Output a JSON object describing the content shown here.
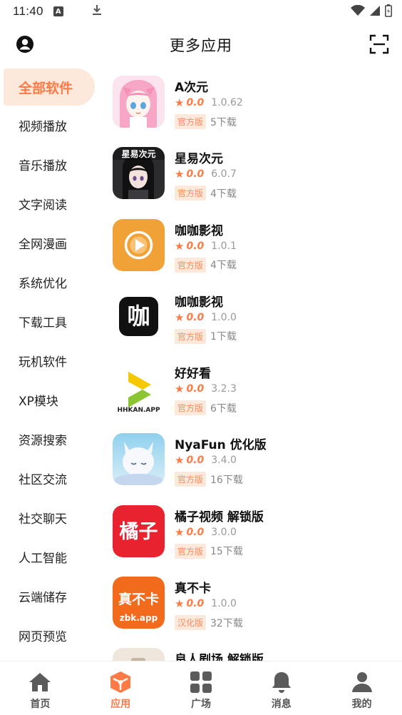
{
  "status_bar": {
    "time": "11:40",
    "a_badge": "A"
  },
  "header": {
    "title": "更多应用"
  },
  "sidebar": {
    "items": [
      {
        "label": "全部软件",
        "active": true
      },
      {
        "label": "视频播放"
      },
      {
        "label": "音乐播放"
      },
      {
        "label": "文字阅读"
      },
      {
        "label": "全网漫画"
      },
      {
        "label": "系统优化"
      },
      {
        "label": "下载工具"
      },
      {
        "label": "玩机软件"
      },
      {
        "label": "XP模块"
      },
      {
        "label": "资源搜索"
      },
      {
        "label": "社区交流"
      },
      {
        "label": "社交聊天"
      },
      {
        "label": "人工智能"
      },
      {
        "label": "云端储存"
      },
      {
        "label": "网页预览"
      }
    ]
  },
  "apps": [
    {
      "name": "A次元",
      "rating": "0.0",
      "version": "1.0.62",
      "tag": "官方版",
      "downloads": "5下载",
      "icon": "anime-girl-pink-icon"
    },
    {
      "name": "星易次元",
      "rating": "0.0",
      "version": "6.0.7",
      "tag": "官方版",
      "downloads": "4下载",
      "icon": "anime-girl-dark-icon",
      "icon_text": "星易次元"
    },
    {
      "name": "咖咖影视",
      "rating": "0.0",
      "version": "1.0.1",
      "tag": "官方版",
      "downloads": "4下载",
      "icon": "play-circle-icon"
    },
    {
      "name": "咖咖影视",
      "rating": "0.0",
      "version": "1.0.0",
      "tag": "官方版",
      "downloads": "1下载",
      "icon": "ka-logo-icon",
      "icon_text": "咖"
    },
    {
      "name": "好好看",
      "rating": "0.0",
      "version": "3.2.3",
      "tag": "官方版",
      "downloads": "6下载",
      "icon": "hhkan-logo-icon",
      "icon_text": "HHKAN.APP"
    },
    {
      "name": "NyaFun 优化版",
      "rating": "0.0",
      "version": "3.4.0",
      "tag": "官方版",
      "downloads": "16下载",
      "icon": "white-cat-icon"
    },
    {
      "name": "橘子视频 解锁版",
      "rating": "0.0",
      "version": "3.0.0",
      "tag": "官方版",
      "downloads": "15下载",
      "icon": "juzi-logo-icon",
      "icon_text": "橘子"
    },
    {
      "name": "真不卡",
      "rating": "0.0",
      "version": "1.0.0",
      "tag": "汉化版",
      "downloads": "32下载",
      "icon": "zbk-logo-icon",
      "icon_text": "真不卡",
      "icon_subtext": "zbk.app"
    },
    {
      "name": "良人剧场 解锁版",
      "rating": "",
      "version": "",
      "tag": "",
      "downloads": "",
      "icon": "partial-icon"
    }
  ],
  "bottom_nav": [
    {
      "label": "首页",
      "icon": "home-icon"
    },
    {
      "label": "应用",
      "icon": "app-cube-icon",
      "active": true
    },
    {
      "label": "广场",
      "icon": "grid-icon"
    },
    {
      "label": "消息",
      "icon": "bell-icon"
    },
    {
      "label": "我的",
      "icon": "user-icon"
    }
  ],
  "colors": {
    "accent": "#ff7a45",
    "accent_bg": "#fde8dc"
  }
}
